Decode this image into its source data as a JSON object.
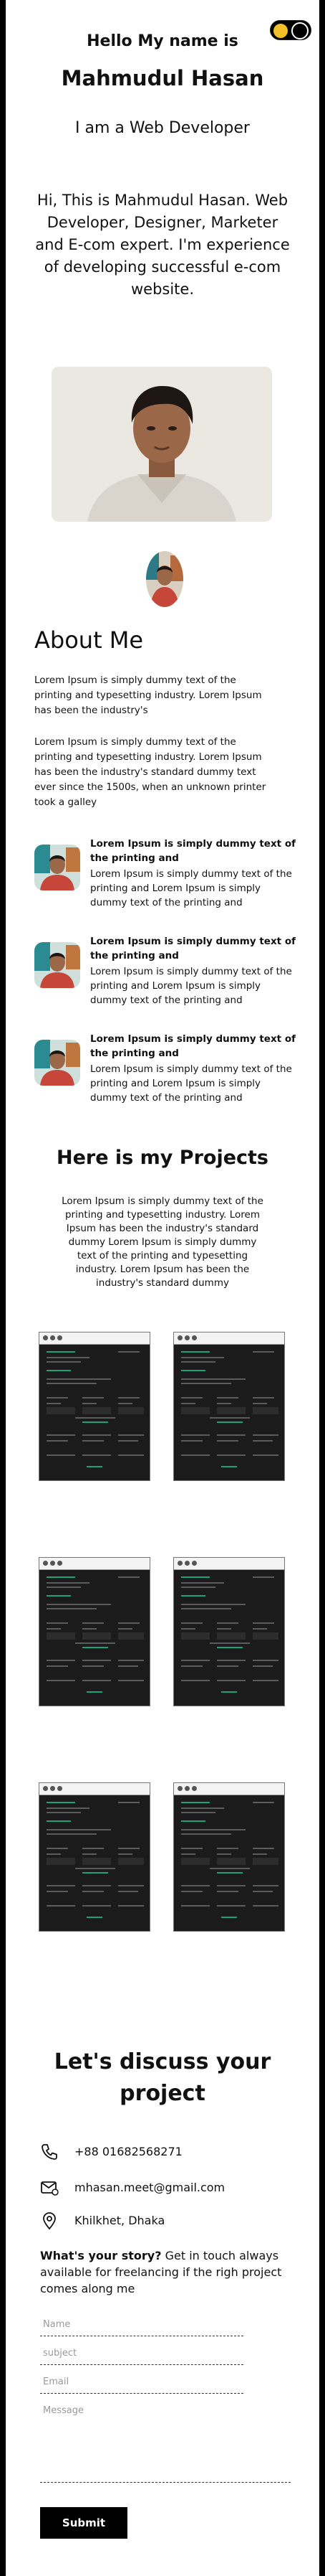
{
  "hero": {
    "greeting": "Hello My name is",
    "name": "Mahmudul Hasan",
    "role": "I am a Web Developer",
    "intro": "Hi, This is Mahmudul Hasan. Web Developer, Designer, Marketer and E-com expert. I'm experience of developing successful e-com website."
  },
  "theme_toggle": {
    "sun_color": "#f2c029",
    "moon_color": "#000000"
  },
  "about": {
    "title": "About Me",
    "paragraph_1": "Lorem Ipsum is simply dummy text of the printing and typesetting industry. Lorem Ipsum has been the industry's",
    "paragraph_2": "Lorem Ipsum is simply dummy text of the printing and typesetting industry. Lorem Ipsum has been the industry's standard dummy text ever since the 1500s, when an unknown printer took a galley",
    "features": [
      {
        "title": "Lorem Ipsum is simply dummy text of the printing and",
        "desc": "Lorem Ipsum is simply dummy text of the printing and Lorem Ipsum is simply dummy text of the printing and"
      },
      {
        "title": "Lorem Ipsum is simply dummy text of the printing and",
        "desc": "Lorem Ipsum is simply dummy text of the printing and Lorem Ipsum is simply dummy text of the printing and"
      },
      {
        "title": "Lorem Ipsum is simply dummy text of the printing and",
        "desc": "Lorem Ipsum is simply dummy text of the printing and Lorem Ipsum is simply dummy text of the printing and"
      }
    ]
  },
  "projects": {
    "title": "Here is my Projects",
    "description": "Lorem Ipsum is simply dummy text of the printing and typesetting industry. Lorem Ipsum has been the industry's standard dummy Lorem Ipsum is simply dummy text of the printing and typesetting industry. Lorem Ipsum has been the industry's standard dummy"
  },
  "contact": {
    "title": "Let's discuss your project",
    "phone": "+88 01682568271",
    "email": "mhasan.meet@gmail.com",
    "location": "Khilkhet, Dhaka",
    "story_lead": "What's your story?",
    "story_text": " Get in touch always available for freelancing if the righ project comes along me",
    "name_placeholder": "Name",
    "subject_placeholder": "subject",
    "email_placeholder": "Email",
    "message_placeholder": "Message",
    "submit_label": "Submit"
  }
}
